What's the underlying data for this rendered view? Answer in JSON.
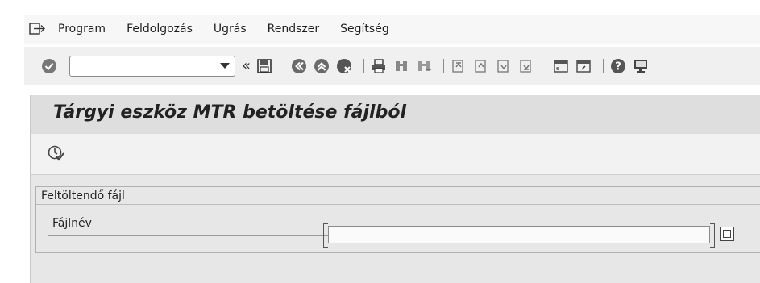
{
  "menu": {
    "items": [
      {
        "label": "Program"
      },
      {
        "label": "Feldolgozás"
      },
      {
        "label": "Ugrás"
      },
      {
        "label": "Rendszer"
      },
      {
        "label": "Segítség"
      }
    ],
    "icons": {
      "menu": "menu-exit-icon"
    }
  },
  "toolbar": {
    "command_value": "",
    "icons": [
      "enter-icon",
      "command-dropdown-icon",
      "collapse-icon",
      "save-icon",
      "back-icon",
      "exit-icon",
      "cancel-icon",
      "print-icon",
      "find-icon",
      "find-next-icon",
      "first-page-icon",
      "previous-page-icon",
      "next-page-icon",
      "last-page-icon",
      "create-session-icon",
      "shortcut-icon",
      "help-icon",
      "layout-icon"
    ],
    "collapse_glyph": "«"
  },
  "screen": {
    "title": "Tárgyi eszköz MTR betöltése fájlból"
  },
  "app_toolbar": {
    "icons": [
      "execute-icon"
    ]
  },
  "group": {
    "title": "Feltöltendő fájl",
    "field_label": "Fájlnév",
    "file_value": ""
  }
}
